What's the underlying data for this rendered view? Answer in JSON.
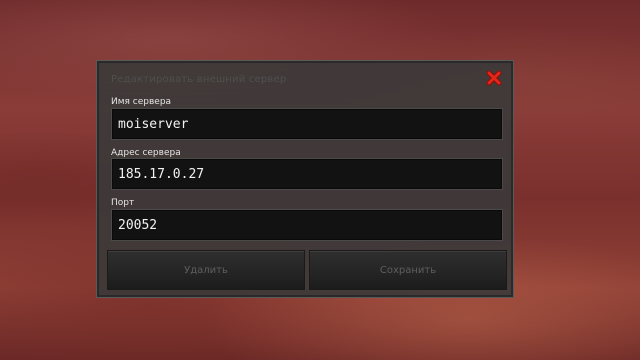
{
  "dialog": {
    "title": "Редактировать внешний сервер",
    "close_icon": "close-icon",
    "close_color": "#e1261c"
  },
  "fields": {
    "server_name": {
      "label": "Имя сервера",
      "value": "moiserver"
    },
    "server_address": {
      "label": "Адрес сервера",
      "value": "185.17.0.27"
    },
    "port": {
      "label": "Порт",
      "value": "20052"
    }
  },
  "buttons": {
    "delete_label": "Удалить",
    "save_label": "Сохранить",
    "enabled": false
  }
}
